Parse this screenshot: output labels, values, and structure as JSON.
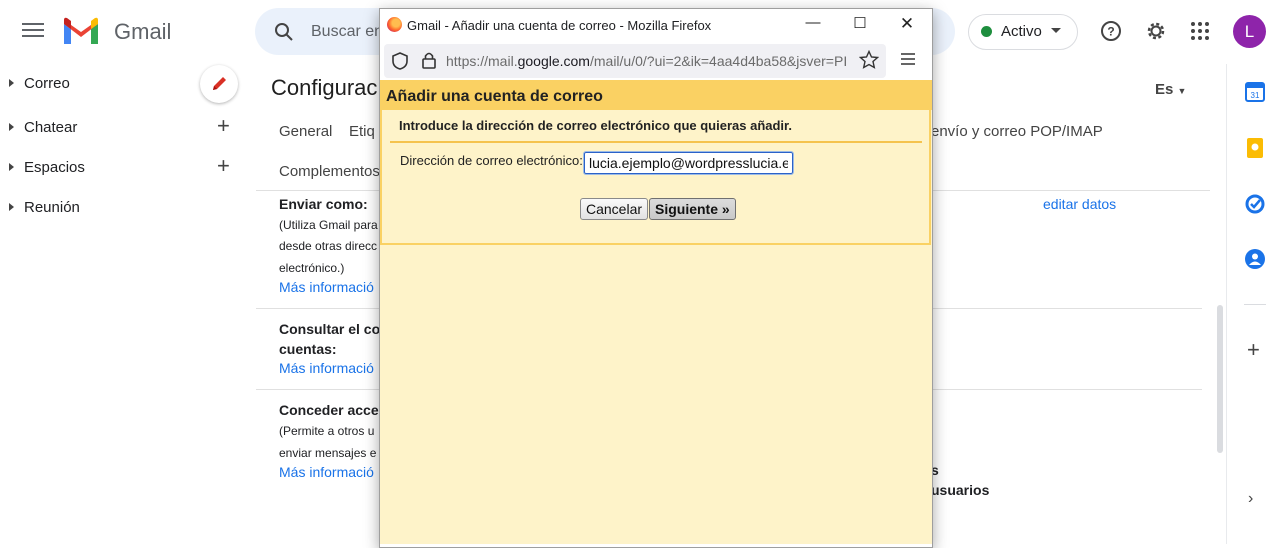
{
  "header": {
    "brand": "Gmail",
    "search_placeholder": "Buscar en",
    "status": "Activo",
    "avatar_letter": "L"
  },
  "nav": {
    "items": [
      {
        "label": "Correo"
      },
      {
        "label": "Chatear"
      },
      {
        "label": "Espacios"
      },
      {
        "label": "Reunión"
      }
    ]
  },
  "settings": {
    "title": "Configurac",
    "lang": "Es",
    "tabs": [
      "General",
      "Etiq",
      "envío y correo POP/IMAP",
      "Complementos"
    ],
    "send_as": {
      "title": "Enviar como:",
      "desc": [
        "(Utiliza Gmail para",
        "desde otras direcc",
        "electrónico.)"
      ],
      "more": "Más informació",
      "edit": "editar datos"
    },
    "check_mail": {
      "title_1": "Consultar el co",
      "title_2": "cuentas:",
      "more": "Más informació"
    },
    "grant_access": {
      "title": "Conceder acces",
      "desc": [
        "(Permite a otros u",
        "enviar mensajes e"
      ],
      "more": "Más informació",
      "right_1": "s",
      "right_2": "usuarios"
    }
  },
  "popup": {
    "window_title": "Gmail - Añadir una cuenta de correo - Mozilla Firefox",
    "url_prefix": "https://mail.",
    "url_domain": "google.com",
    "url_rest": "/mail/u/0/?ui=2&ik=4aa4d4ba58&jsver=PI",
    "dialog_title": "Añadir una cuenta de correo",
    "instruction": "Introduce la dirección de correo electrónico que quieras añadir.",
    "field_label": "Dirección de correo electrónico:",
    "email_value": "lucia.ejemplo@wordpresslucia.es",
    "cancel_label": "Cancelar",
    "next_label": "Siguiente »"
  },
  "colors": {
    "accent_blue": "#1a73e8",
    "dialog_header": "#fad163",
    "dialog_bg": "#fef3c9",
    "status_green": "#1e8e3e"
  },
  "icons": [
    "menu-icon",
    "gmail-logo",
    "search-icon",
    "help-icon",
    "gear-icon",
    "apps-icon",
    "pencil-icon",
    "plus-icon",
    "calendar-icon",
    "keep-icon",
    "tasks-icon",
    "contacts-icon",
    "firefox-icon",
    "shield-icon",
    "lock-icon",
    "star-icon",
    "chevron-right-icon"
  ]
}
